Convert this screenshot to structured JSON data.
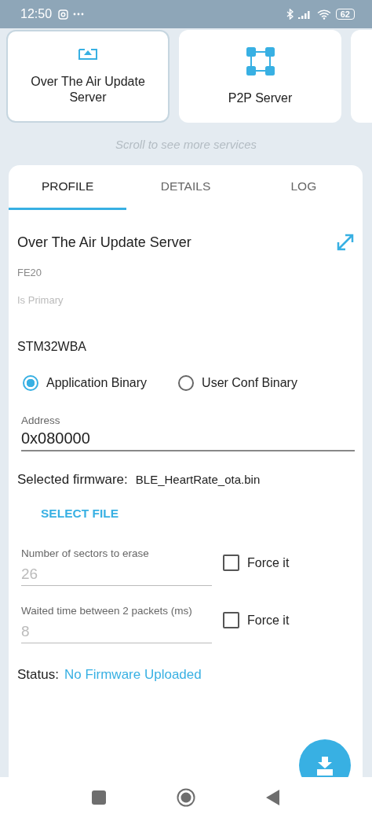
{
  "status_bar": {
    "time": "12:50",
    "battery": "62"
  },
  "services": [
    {
      "label": "Over The Air Update Server",
      "kind": "upload",
      "selected": true
    },
    {
      "label": "P2P Server",
      "kind": "network",
      "selected": false
    },
    {
      "kind": "blank",
      "selected": false
    }
  ],
  "scroll_hint": "Scroll to see more services",
  "tabs": [
    {
      "label": "PROFILE",
      "selected": true
    },
    {
      "label": "DETAILS",
      "selected": false
    },
    {
      "label": "LOG",
      "selected": false
    }
  ],
  "profile": {
    "title": "Over The Air Update Server",
    "uuid": "FE20",
    "primary": "Is Primary",
    "board": "STM32WBA",
    "binary_options": [
      {
        "label": "Application Binary",
        "selected": true
      },
      {
        "label": "User Conf Binary",
        "selected": false
      }
    ],
    "address": {
      "label": "Address",
      "value": "0x080000"
    },
    "firmware": {
      "label": "Selected firmware:",
      "value": "BLE_HeartRate_ota.bin"
    },
    "select_button": "SELECT FILE",
    "settings": [
      {
        "label": "Number of sectors to erase",
        "placeholder": "26",
        "force_label": "Force it",
        "checked": false
      },
      {
        "label": "Waited time between 2 packets (ms)",
        "placeholder": "8",
        "force_label": "Force it",
        "checked": false
      }
    ],
    "status": {
      "label": "Status:",
      "value": "No Firmware Uploaded"
    }
  }
}
